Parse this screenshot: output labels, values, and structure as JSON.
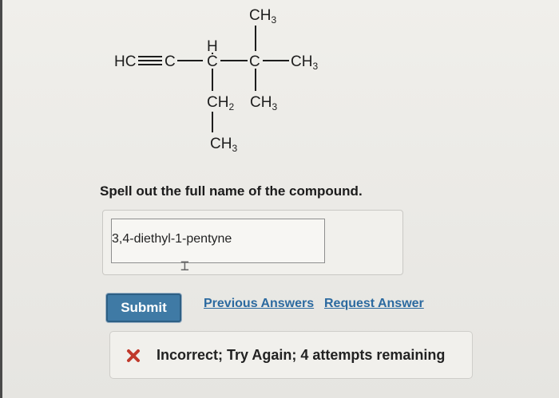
{
  "structure": {
    "hc": "HC",
    "c_alkyne": "C",
    "h_top": "H",
    "c3": "C",
    "c4": "C",
    "ch3_top": "CH",
    "ch3_right": "CH",
    "ch2": "CH",
    "ch3_under_c4": "CH",
    "ch3_bottom": "CH",
    "sub3": "3",
    "sub2": "2"
  },
  "question": {
    "prompt": "Spell out the full name of the compound."
  },
  "answer": {
    "value": "3,4-diethyl-1-pentyne"
  },
  "actions": {
    "submit_label": "Submit",
    "previous_answers_label": "Previous Answers",
    "request_answer_label": "Request Answer"
  },
  "feedback": {
    "message": "Incorrect; Try Again; 4 attempts remaining",
    "status_color": "#c0392b"
  },
  "colors": {
    "accent": "#3f7aa5",
    "link": "#2c6aa0"
  }
}
